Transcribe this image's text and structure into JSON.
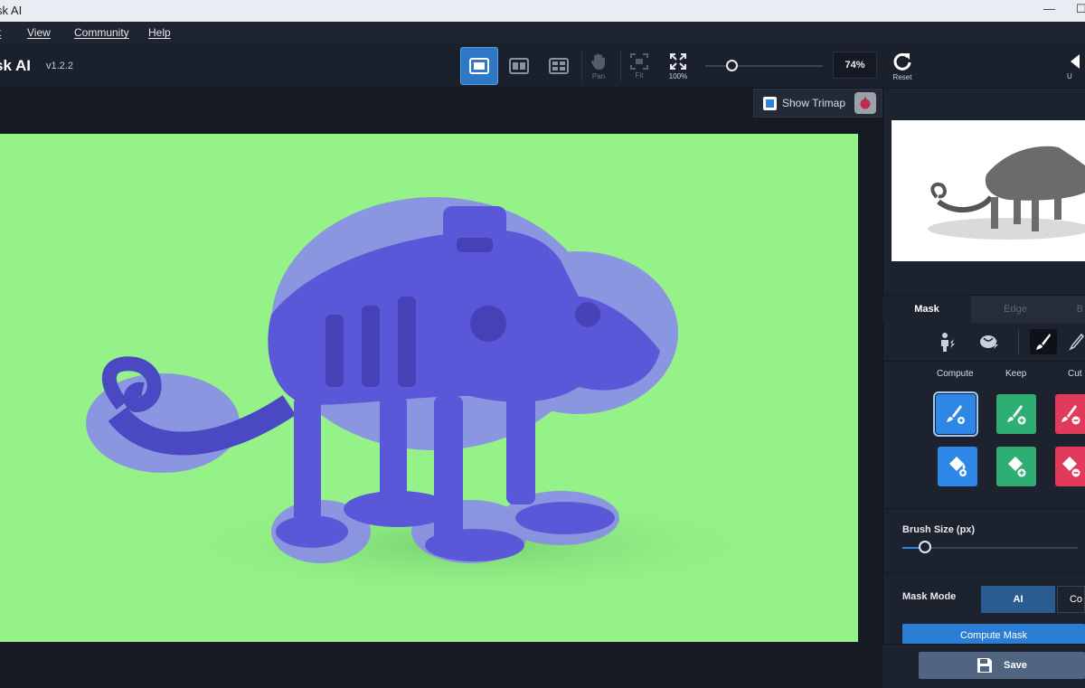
{
  "window": {
    "title": "sk AI",
    "minimize": "—",
    "maximize": "☐"
  },
  "menu": [
    {
      "label": "t"
    },
    {
      "label": "View"
    },
    {
      "label": "Community"
    },
    {
      "label": "Help"
    }
  ],
  "toolbar": {
    "app_name": "sk AI",
    "version": "v1.2.2",
    "pan_label": "Pan",
    "fit_label": "Fit",
    "zoom100_label": "100%",
    "zoom_value": "74%",
    "zoom_level_percent": 74,
    "reset_label": "Reset",
    "undo_label": "U"
  },
  "canvas": {
    "show_trimap_label": "Show Trimap",
    "show_trimap_checked": true,
    "background_color": "#94f288",
    "mask_color": "#6d6be8"
  },
  "panel": {
    "tabs": [
      "Mask",
      "Edge",
      "B"
    ],
    "active_tab": "Mask",
    "columns": [
      "Compute",
      "Keep",
      "Cut"
    ],
    "brush_size_label": "Brush Size (px)",
    "brush_size_fraction": 0.13,
    "mask_mode_label": "Mask Mode",
    "mask_modes": [
      "AI",
      "Co"
    ],
    "active_mask_mode": "AI",
    "compute_mask_label": "Compute Mask",
    "save_label": "Save",
    "colors": {
      "compute": "#2e86e6",
      "keep": "#2fae74",
      "cut": "#e13a5c",
      "accent": "#2a7fd4"
    }
  }
}
